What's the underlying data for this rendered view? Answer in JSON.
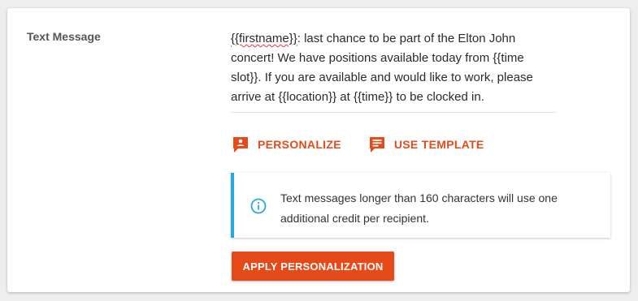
{
  "field": {
    "label": "Text Message"
  },
  "message": {
    "token": "{{firstname}}",
    "body": ": last chance to be part of the Elton John concert! We have positions available today from {{time slot}}. If you are available and would like to work, please arrive at {{location}} at {{time}} to be clocked in."
  },
  "actions": {
    "personalize": {
      "label": "PERSONALIZE",
      "icon": "personalize-icon"
    },
    "template": {
      "label": "USE TEMPLATE",
      "icon": "template-icon"
    }
  },
  "info": {
    "icon": "info-icon",
    "text": "Text messages longer than 160 characters will use one additional credit per recipient."
  },
  "apply_button": {
    "label": "APPLY PERSONALIZATION"
  },
  "colors": {
    "accent": "#e64a19",
    "info_border": "#29a8e0"
  }
}
